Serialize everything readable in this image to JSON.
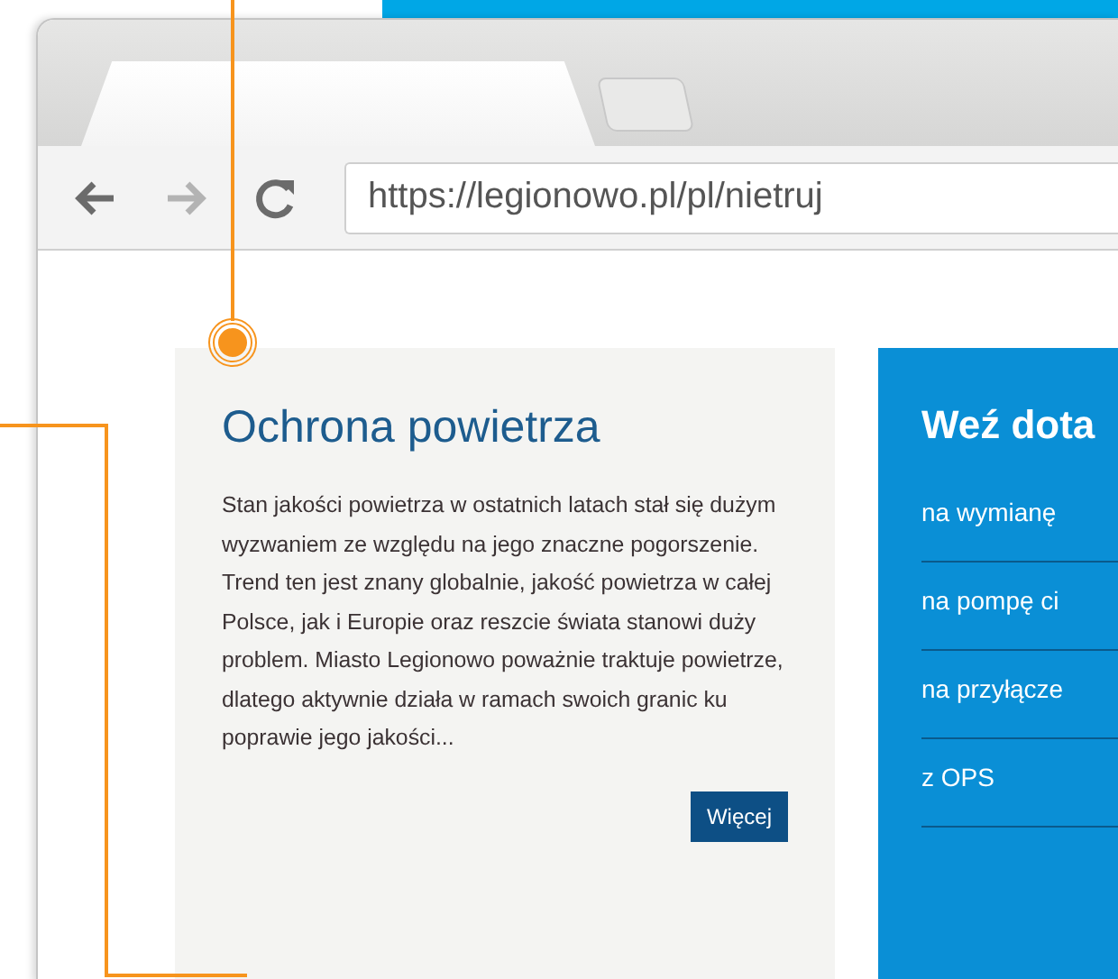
{
  "browser": {
    "tabs": [
      {
        "selected": true
      },
      {
        "selected": false
      }
    ],
    "nav": [
      {
        "kind": "back",
        "disabled": false
      },
      {
        "kind": "forward",
        "disabled": true
      },
      {
        "kind": "reload",
        "disabled": false
      }
    ],
    "url": "https://legionowo.pl/pl/nietruj"
  },
  "article": {
    "title": "Ochrona powietrza",
    "body": "Stan jakości powietrza w ostatnich latach stał się dużym wyzwaniem ze względu na jego znaczne pogorszenie. Trend ten jest znany globalnie, jakość powietrza w całej Polsce, jak i Europie oraz reszcie świata stanowi duży problem. Miasto Legionowo poważnie traktuje powietrze, dlatego aktywnie działa w ramach swoich granic ku poprawie jego jakości...",
    "button": "Więcej"
  },
  "sidebar": {
    "title": "Weź dota",
    "links": [
      "na wymianę",
      "na pompę ci",
      "na przyłącze",
      "z OPS"
    ]
  }
}
